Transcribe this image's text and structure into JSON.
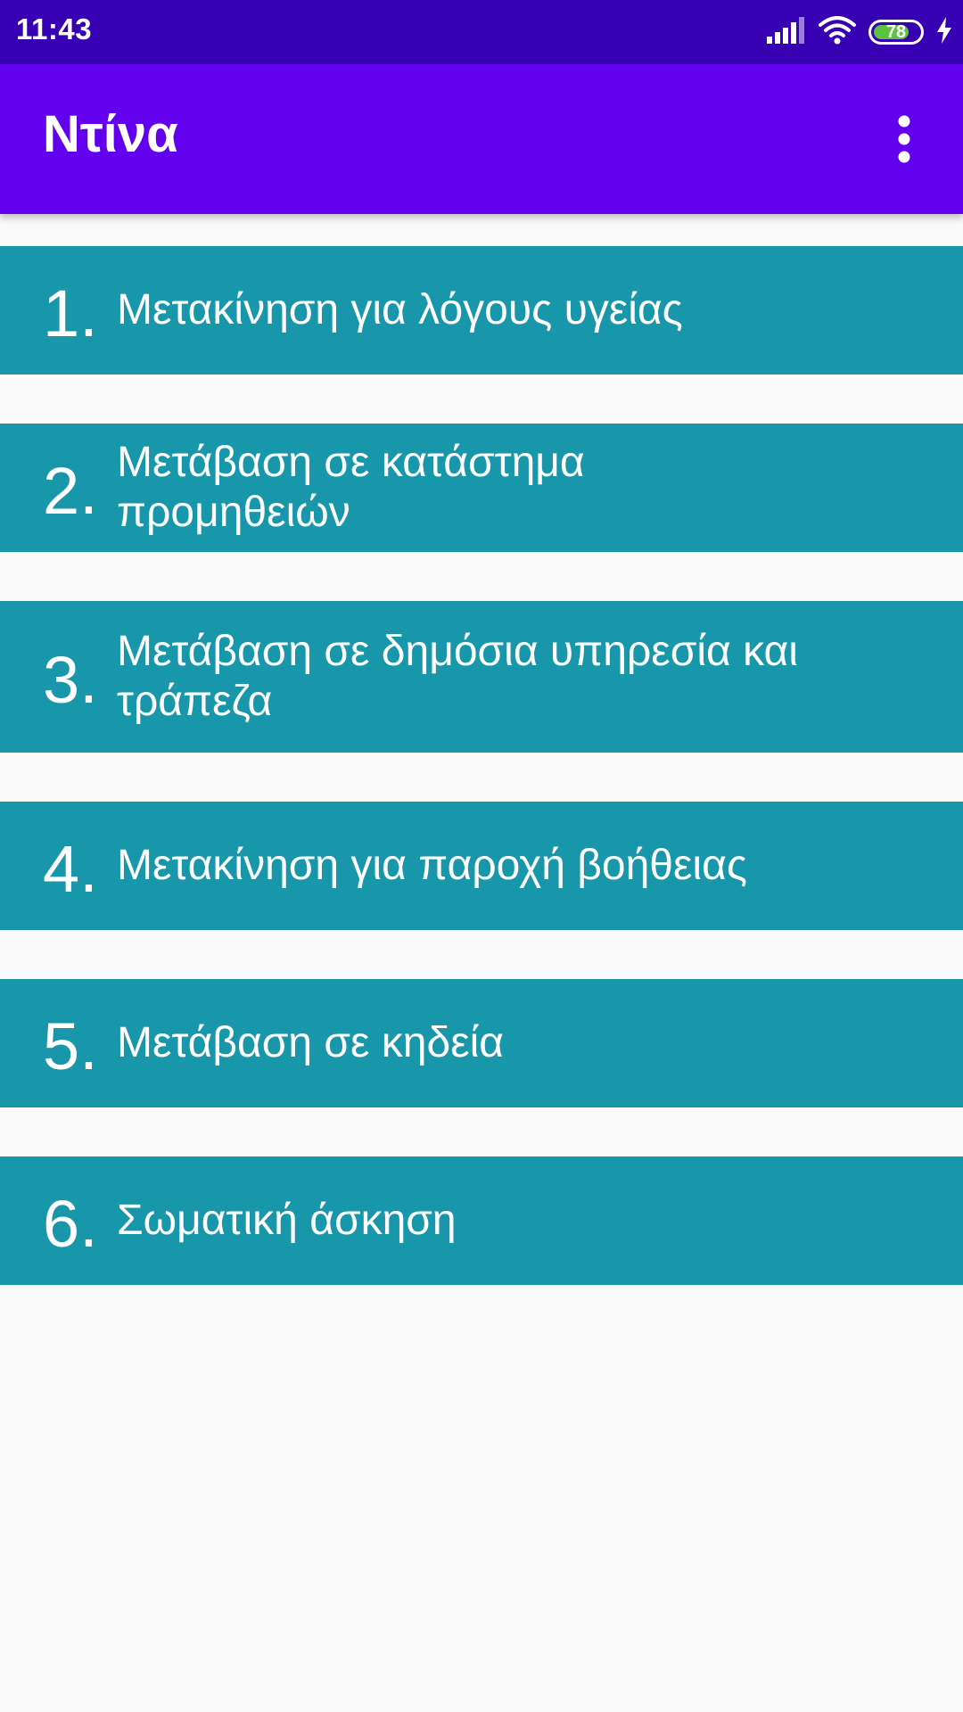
{
  "status_bar": {
    "time": "11:43",
    "battery_level": "78",
    "battery_fraction": 0.78,
    "icons": [
      "signal-icon",
      "wifi-icon",
      "battery-icon",
      "charging-icon"
    ]
  },
  "app_bar": {
    "title": "Ντίνα",
    "menu_icon": "more-vert-icon"
  },
  "colors": {
    "status_bar": "#3700b3",
    "app_bar": "#6200ee",
    "item_background": "#1797a9",
    "page_background": "#fafafa",
    "battery_fill": "#5cc23f"
  },
  "items": [
    {
      "number": "1.",
      "label": "Μετακίνηση για λόγους υγείας"
    },
    {
      "number": "2.",
      "label": "Μετάβαση σε κατάστημα προμηθειών"
    },
    {
      "number": "3.",
      "label": "Μετάβαση σε δημόσια υπηρεσία και τράπεζα"
    },
    {
      "number": "4.",
      "label": "Μετακίνηση για παροχή βοήθειας"
    },
    {
      "number": "5.",
      "label": "Μετάβαση σε κηδεία"
    },
    {
      "number": "6.",
      "label": "Σωματική άσκηση"
    }
  ]
}
